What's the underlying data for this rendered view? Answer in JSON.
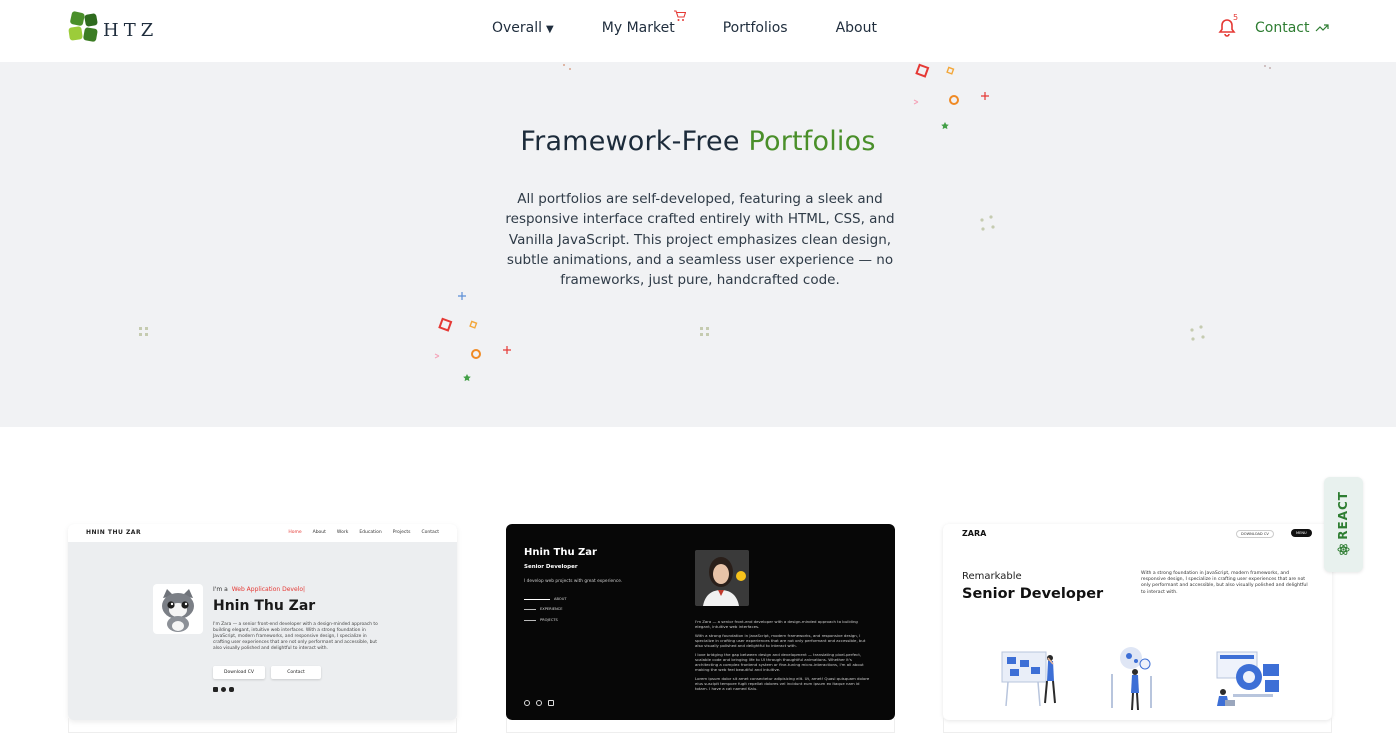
{
  "nav": {
    "logo_text": "HTZ",
    "items": [
      {
        "label": "Overall",
        "caret": "▼"
      },
      {
        "label": "My Market"
      },
      {
        "label": "Portfolios"
      },
      {
        "label": "About"
      }
    ],
    "notification_count": "5",
    "contact_label": "Contact"
  },
  "hero": {
    "title_plain": "Framework-Free ",
    "title_accent": "Portfolios",
    "description": "All portfolios are self-developed, featuring a sleek and responsive interface crafted entirely with HTML, CSS, and Vanilla JavaScript. This project emphasizes clean design, subtle animations, and a seamless user experience — no frameworks, just pure, handcrafted code."
  },
  "cards": [
    {
      "name": "HNIN THU ZAR",
      "nav": [
        "Home",
        "About",
        "Work",
        "Education",
        "Projects",
        "Contact"
      ],
      "greeting": "I'm a",
      "role": "Web Application Develo|",
      "heading": "Hnin Thu Zar",
      "text": "I'm Zara — a senior front-end developer with a design-minded approach to building elegant, intuitive web interfaces. With a strong foundation in JavaScript, modern frameworks, and responsive design, I specialize in crafting user experiences that are not only performant and accessible, but also visually polished and delightful to interact with.",
      "btn_download": "Download CV",
      "btn_contact": "Contact"
    },
    {
      "name": "Hnin Thu Zar",
      "title": "Senior Developer",
      "tagline": "I develop web projects with great experience.",
      "links": [
        "ABOUT",
        "EXPERIENCE",
        "PROJECTS"
      ],
      "paragraphs": [
        "I'm Zara — a senior front-end developer with a design-minded approach to building elegant, intuitive web interfaces.",
        "With a strong foundation in JavaScript, modern frameworks, and responsive design, I specialize in crafting user experiences that are not only performant and accessible, but also visually polished and delightful to interact with.",
        "I love bridging the gap between design and development — translating pixel-perfect, scalable code and bringing life to UI through thoughtful animations. Whether it's architecting a complex frontend system or fine-tuning micro-interactions, I'm all about making the web feel beautiful and intuitive.",
        "Lorem ipsum dolor sit amet consectetur adipisicing elit. Ut, amet! Quasi quisquam dolore eius suscipit tempore fugit repellat dolores vel incidunt eum ipsum ex itaque nam id totam. I have a cat named Kaiu."
      ]
    },
    {
      "logo": "ZARA",
      "download": "DOWNLOAD CV",
      "menu": "MENU",
      "small": "Remarkable",
      "heading": "Senior Developer",
      "text": "With a strong foundation in JavaScript, modern frameworks, and responsive design, I specialize in crafting user experiences that are not only performant and accessible, but also visually polished and delightful to interact with."
    }
  ],
  "react_badge": "REACT",
  "colors": {
    "accent_green": "#4a8f2a",
    "alert_red": "#e53935",
    "hero_bg": "#f1f2f4"
  }
}
